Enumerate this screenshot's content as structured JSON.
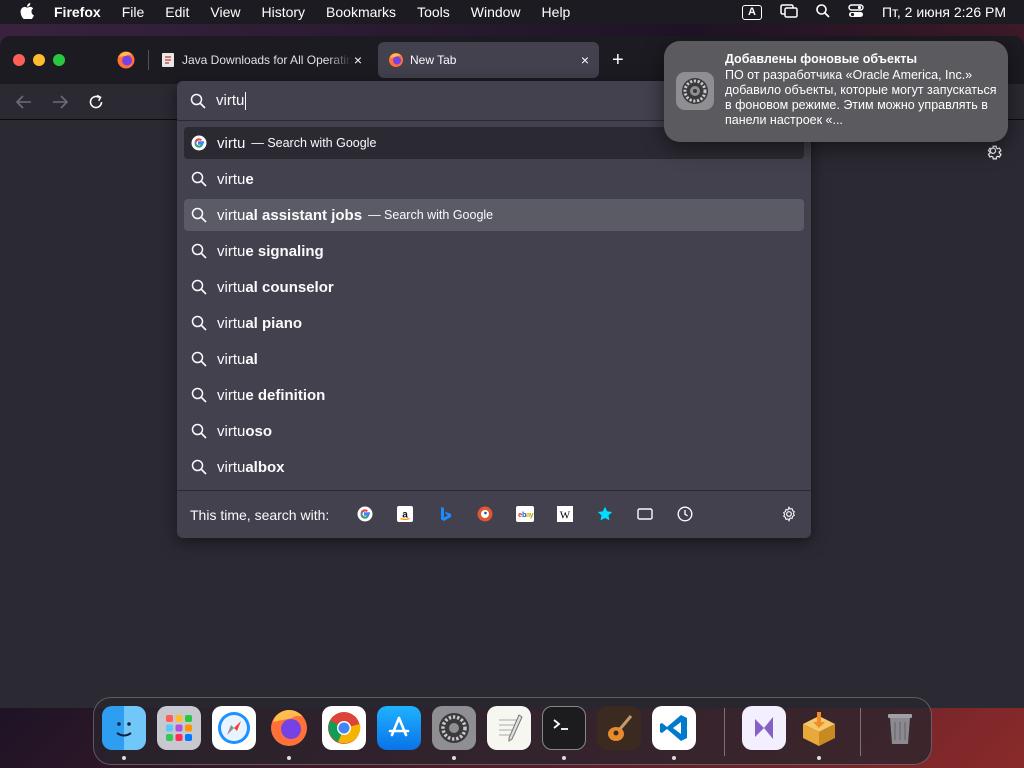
{
  "menubar": {
    "app": "Firefox",
    "items": [
      "File",
      "Edit",
      "View",
      "History",
      "Bookmarks",
      "Tools",
      "Window",
      "Help"
    ],
    "keyboard_indicator": "A",
    "datetime": "Пт, 2 июня  2:26 PM"
  },
  "tabs": [
    {
      "title": "Java Downloads for All Operating Systems",
      "close": "×"
    },
    {
      "title": "New Tab",
      "close": "×"
    }
  ],
  "new_tab_label": "+",
  "urlbar": {
    "value": "virtu"
  },
  "suggestions": [
    {
      "typed": "virtu",
      "rest": "",
      "hint": "— Search with Google",
      "icon": "google-icon"
    },
    {
      "typed": "virtu",
      "rest": "e",
      "hint": "",
      "icon": "search-icon"
    },
    {
      "typed": "virtu",
      "rest": "al assistant jobs",
      "hint": "— Search with Google",
      "icon": "search-icon"
    },
    {
      "typed": "virtu",
      "rest": "e signaling",
      "hint": "",
      "icon": "search-icon"
    },
    {
      "typed": "virtu",
      "rest": "al counselor",
      "hint": "",
      "icon": "search-icon"
    },
    {
      "typed": "virtu",
      "rest": "al piano",
      "hint": "",
      "icon": "search-icon"
    },
    {
      "typed": "virtu",
      "rest": "al",
      "hint": "",
      "icon": "search-icon"
    },
    {
      "typed": "virtu",
      "rest": "e definition",
      "hint": "",
      "icon": "search-icon"
    },
    {
      "typed": "virtu",
      "rest": "oso",
      "hint": "",
      "icon": "search-icon"
    },
    {
      "typed": "virtu",
      "rest": "albox",
      "hint": "",
      "icon": "search-icon"
    }
  ],
  "one_off": {
    "label": "This time, search with:",
    "engines": [
      "google",
      "amazon",
      "bing",
      "duckduckgo",
      "ebay",
      "wikipedia",
      "bookmarks",
      "tabs",
      "history"
    ]
  },
  "notification": {
    "title": "Добавлены фоновые объекты",
    "body": "ПО от разработчика «Oracle America, Inc.» добавило объекты, которые могут запускаться в фоновом режиме. Этим можно управлять в панели настроек «..."
  },
  "dock": [
    "finder",
    "launchpad",
    "safari",
    "firefox",
    "chrome",
    "app-store",
    "system-settings",
    "textedit",
    "terminal",
    "garageband",
    "vscode",
    "visual-studio",
    "installer",
    "trash"
  ],
  "colors": {
    "panel": "#42414d",
    "selected": "#5b5b66",
    "accent": "#00ddff"
  }
}
